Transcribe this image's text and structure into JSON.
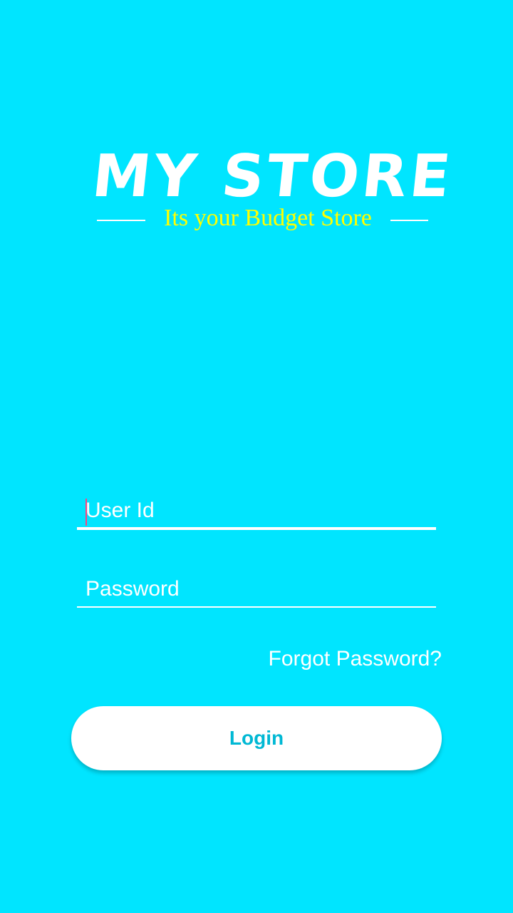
{
  "theme": {
    "background": "#00E5FF",
    "accent_text": "#00B8D4",
    "tagline_color": "#FFFF00",
    "cursor_color": "#FF4081"
  },
  "logo": {
    "title": "MY STORE",
    "tagline": "Its your Budget Store"
  },
  "login_form": {
    "user_id": {
      "placeholder": "User Id",
      "value": ""
    },
    "password": {
      "placeholder": "Password",
      "value": ""
    },
    "forgot_password_label": "Forgot Password?",
    "login_label": "Login"
  }
}
